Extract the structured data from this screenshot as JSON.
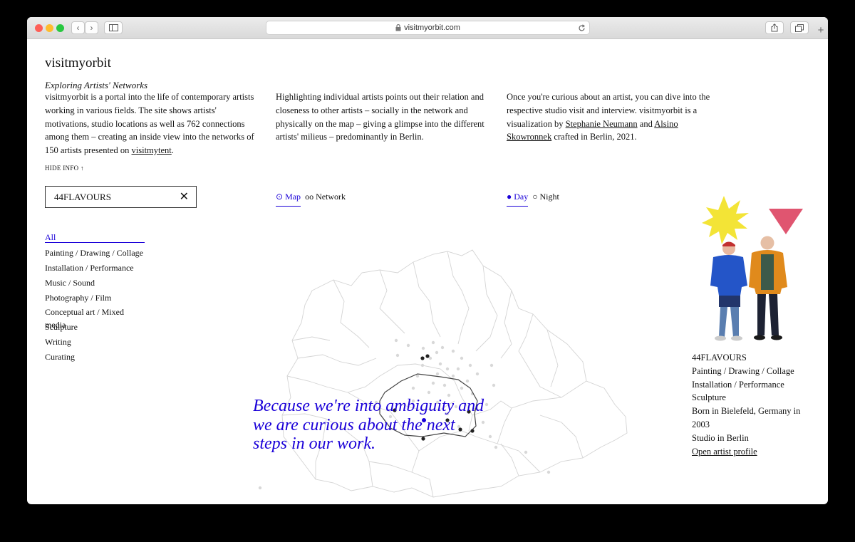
{
  "browser": {
    "url": "visitmyorbit.com",
    "buttons": {
      "back": "‹",
      "forward": "›",
      "new_tab": "+"
    }
  },
  "site": {
    "title": "visitmyorbit",
    "subtitle": "Exploring Artists' Networks",
    "intro": {
      "col1_text": "visitmyorbit is a portal into the life of contemporary artists working in various fields. The site shows artists' motivations, studio locations as well as 762 connections among them – creating an inside view into the networks of 150 artists presented on ",
      "col1_link": "visitmytent",
      "col1_end": ".",
      "col2_text": "Highlighting individual artists points out their relation and closeness to other artists – socially in the network and physically on the map – giving a glimpse into the different artists' milieus – predominantly in Berlin.",
      "col3_text": "Once you're curious about an artist, you can dive into the respective studio visit and interview. visitmyorbit is a visualization by ",
      "col3_link1": "Stephanie Neumann",
      "col3_and": " and ",
      "col3_link2": "Alsino Skowronnek",
      "col3_end": " crafted in Berlin, 2021."
    },
    "hide_info": "HIDE INFO ↑"
  },
  "search": {
    "value": "44FLAVOURS",
    "clear_symbol": "✕"
  },
  "categories": [
    "All",
    "Painting / Drawing / Collage",
    "Installation / Performance",
    "Music / Sound",
    "Photography / Film",
    "Conceptual art / Mixed media",
    "Sculpture",
    "Writing",
    "Curating"
  ],
  "view_toggle": {
    "map_symbol": "⊙",
    "map": "Map",
    "network_symbol": "oo",
    "network": "Network"
  },
  "time_toggle": {
    "day_symbol": "●",
    "day": "Day",
    "night_symbol": "○",
    "night": "Night"
  },
  "quote": "Because we're into ambiguity and we are curious about the next steps in our work.",
  "artist": {
    "name": "44FLAVOURS",
    "categories": [
      "Painting / Drawing / Collage",
      "Installation / Performance",
      "Sculpture"
    ],
    "born": "Born in Bielefeld, Germany in 2003",
    "studio": "Studio in Berlin",
    "profile_link": "Open artist profile"
  },
  "colors": {
    "accent": "#1a00d8",
    "star": "#f3e436",
    "triangle": "#e05570"
  }
}
